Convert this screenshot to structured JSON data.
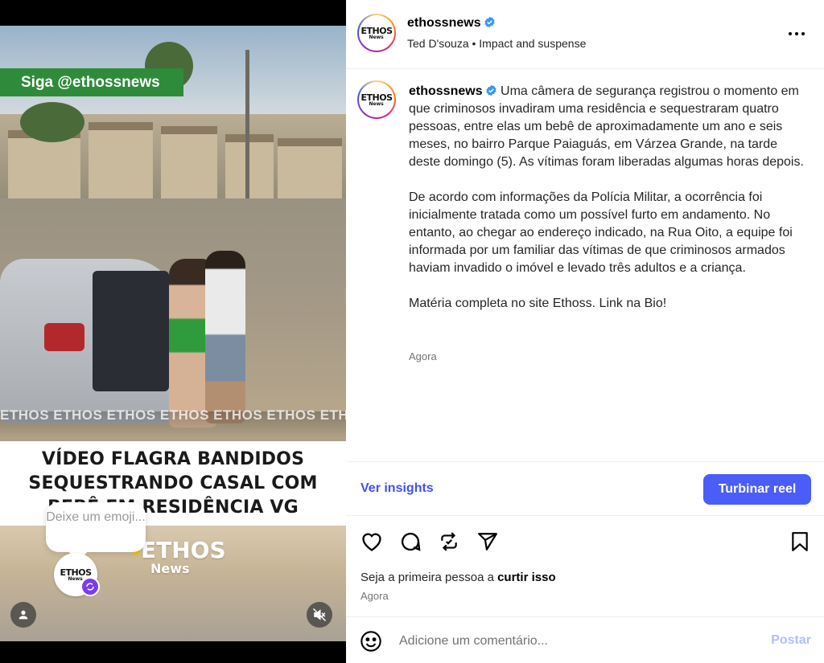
{
  "media": {
    "follow_banner": "Siga @ethossnews",
    "watermark": "ETHOS ETHOS ETHOS ETHOS ETHOS ETHOS ETHOS ETHOS",
    "headline": "VÍDEO FLAGRA BANDIDOS SEQUESTRANDO CASAL COM BEBÊ EM RESIDÊNCIA VG",
    "brand_logo": "ETHOS",
    "brand_logo_sub": "News",
    "emoji_prompt": "Deixe um emoji...",
    "mini_logo": "ETHOS",
    "mini_logo_sub": "News"
  },
  "header": {
    "username": "ethossnews",
    "verified": true,
    "subtitle": "Ted D'souza • Impact and suspense",
    "more_icon": "more-horizontal-icon"
  },
  "caption": {
    "username": "ethossnews",
    "paragraph1": "Uma câmera de segurança registrou o momento em que criminosos invadiram uma residência e sequestraram quatro pessoas, entre elas um bebê de aproximadamente um ano e seis meses, no bairro Parque Paiaguás, em Várzea Grande, na tarde deste domingo (5). As vítimas foram liberadas algumas horas depois.",
    "paragraph2": "De acordo com informações da Polícia Militar, a ocorrência foi inicialmente tratada como um possível furto em andamento. No entanto, ao chegar ao endereço indicado, na Rua Oito, a equipe foi informada por um familiar das vítimas de que criminosos armados haviam invadido o imóvel e levado três adultos e a criança.",
    "paragraph3": "Matéria completa no site Ethoss. Link na Bio!",
    "time": "Agora"
  },
  "insights": {
    "link_label": "Ver insights",
    "boost_label": "Turbinar reel"
  },
  "actions": {
    "like_icon": "heart-icon",
    "comment_icon": "comment-icon",
    "repost_icon": "repost-icon",
    "share_icon": "share-icon",
    "save_icon": "bookmark-icon"
  },
  "likes": {
    "prefix": "Seja a primeira pessoa a ",
    "action": "curtir isso",
    "time": "Agora"
  },
  "comment": {
    "placeholder": "Adicione um comentário...",
    "post_label": "Postar"
  },
  "colors": {
    "accent": "#4a5df9",
    "link": "#4150f7",
    "banner_green": "#2e8b3a",
    "verified_blue": "#3897f0"
  }
}
